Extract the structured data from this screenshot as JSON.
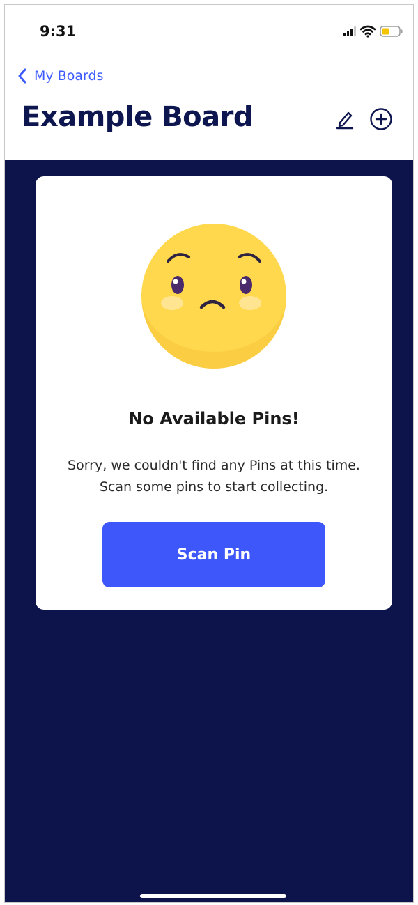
{
  "status_bar": {
    "time": "9:31",
    "icons": [
      "cellular-signal-icon",
      "wifi-icon",
      "battery-icon"
    ],
    "battery_color": "#f5c400"
  },
  "header": {
    "back_label": "My Boards",
    "title": "Example Board",
    "icons": {
      "back": "chevron-left-icon",
      "edit": "pencil-icon",
      "add": "plus-circle-icon"
    }
  },
  "empty_state": {
    "icon": "sad-face-emoji-icon",
    "title": "No Available Pins!",
    "message": "Sorry, we couldn't find any Pins at this time. Scan some pins to start collecting.",
    "button_label": "Scan Pin"
  },
  "colors": {
    "accent": "#3d57fa",
    "title_navy": "#0e1650",
    "background_navy": "#0c144b",
    "emoji_yellow": "#ffd84d"
  }
}
